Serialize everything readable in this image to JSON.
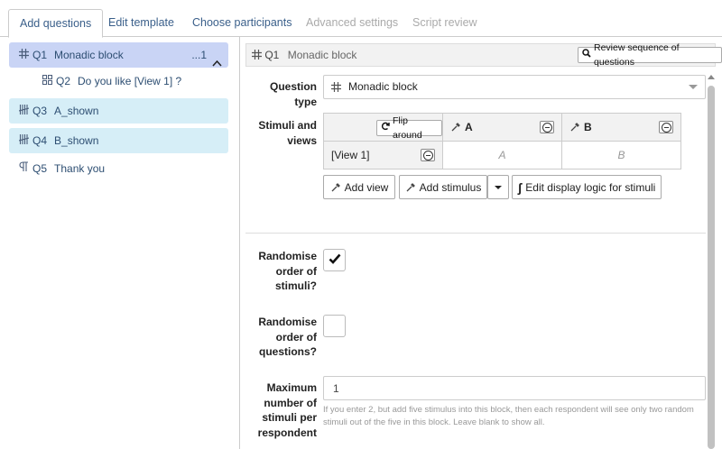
{
  "tabs": [
    {
      "label": "Add questions"
    },
    {
      "label": "Edit template"
    },
    {
      "label": "Choose participants"
    },
    {
      "label": "Advanced settings"
    },
    {
      "label": "Script review"
    }
  ],
  "questions": [
    {
      "num": "Q1",
      "title": "Monadic block",
      "icon": "grid-icon",
      "extra": "...1"
    },
    {
      "num": "Q2",
      "title": "Do you like [View 1] ?",
      "icon": "matrix-icon"
    },
    {
      "num": "Q3",
      "title": "A_shown",
      "icon": "tally-icon"
    },
    {
      "num": "Q4",
      "title": "B_shown",
      "icon": "tally-icon"
    },
    {
      "num": "Q5",
      "title": "Thank you",
      "icon": "paragraph-icon"
    }
  ],
  "editor": {
    "header_num": "Q1",
    "header_title": "Monadic block",
    "review_button": "Review sequence of questions",
    "question_type_label": "Question type",
    "question_type_value": "Monadic block",
    "stimuli_label": "Stimuli and views",
    "flip_button": "Flip around",
    "stimuli": [
      "A",
      "B"
    ],
    "views": [
      "[View 1]"
    ],
    "cells": [
      "A",
      "B"
    ],
    "add_view": "Add view",
    "add_stimulus": "Add stimulus",
    "edit_logic": "Edit display logic for stimuli",
    "randomise_stimuli_label": "Randomise order of stimuli?",
    "randomise_stimuli_checked": true,
    "randomise_questions_label": "Randomise order of questions?",
    "randomise_questions_checked": false,
    "max_stimuli_label": "Maximum number of stimuli per respondent",
    "max_stimuli_value": "1",
    "max_stimuli_help": "If you enter 2, but add five stimulus into this block, then each respondent will see only two random stimuli out of the five in this block. Leave blank to show all."
  }
}
